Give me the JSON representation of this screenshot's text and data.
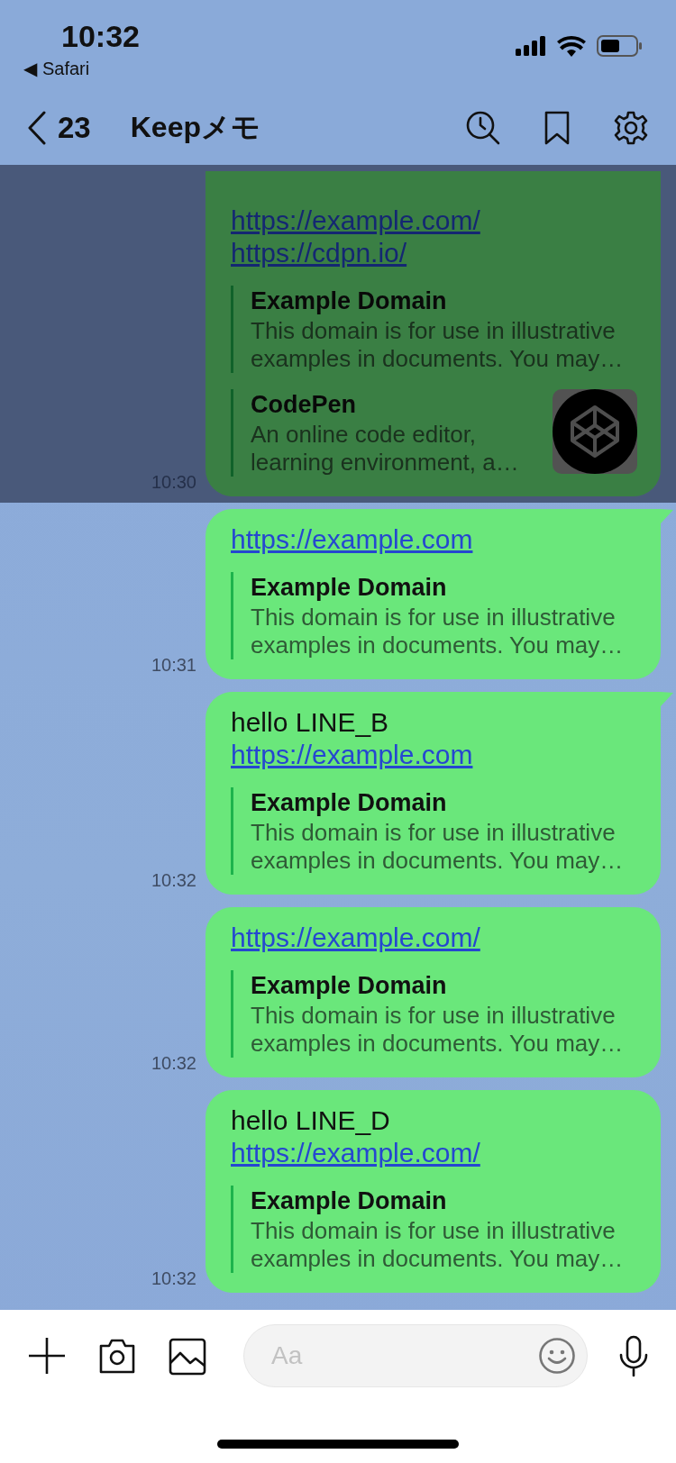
{
  "status_bar": {
    "time": "10:32",
    "back_app": "◀ Safari"
  },
  "header": {
    "back_count": "23",
    "title": "Keepメモ"
  },
  "messages": [
    {
      "selected": true,
      "tail": false,
      "time": "10:30",
      "links": [
        "https://example.com/",
        "https://cdpn.io/"
      ],
      "previews": [
        {
          "title": "Example Domain",
          "description": "This domain is for use in illustrative examples in documents. You may…",
          "thumbnail": false
        },
        {
          "title": "CodePen",
          "description": "An online code editor, learning environment, a…",
          "thumbnail": true
        }
      ]
    },
    {
      "selected": false,
      "tail": true,
      "time": "10:31",
      "links": [
        "https://example.com"
      ],
      "previews": [
        {
          "title": "Example Domain",
          "description": "This domain is for use in illustrative examples in documents. You may…",
          "thumbnail": false
        }
      ]
    },
    {
      "selected": false,
      "tail": true,
      "time": "10:32",
      "text": "hello LINE_B",
      "links": [
        "https://example.com"
      ],
      "previews": [
        {
          "title": "Example Domain",
          "description": "This domain is for use in illustrative examples in documents. You may…",
          "thumbnail": false
        }
      ]
    },
    {
      "selected": false,
      "tail": false,
      "time": "10:32",
      "links": [
        "https://example.com/"
      ],
      "previews": [
        {
          "title": "Example Domain",
          "description": "This domain is for use in illustrative examples in documents. You may…",
          "thumbnail": false
        }
      ]
    },
    {
      "selected": false,
      "tail": false,
      "time": "10:32",
      "text": "hello LINE_D",
      "links": [
        "https://example.com/"
      ],
      "previews": [
        {
          "title": "Example Domain",
          "description": "This domain is for use in illustrative examples in documents. You may…",
          "thumbnail": false
        }
      ]
    }
  ],
  "composer": {
    "placeholder": "Aa"
  }
}
